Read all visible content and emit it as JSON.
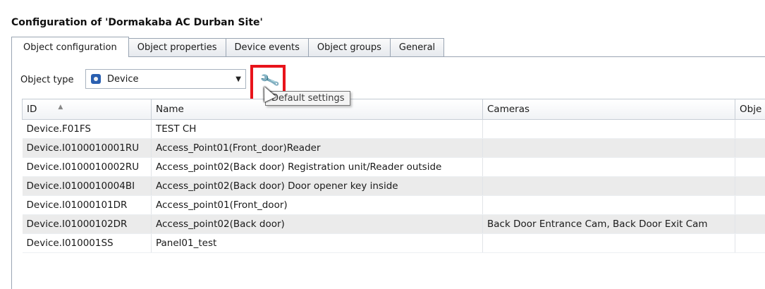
{
  "window": {
    "title": "Configuration of 'Dormakaba AC Durban Site'"
  },
  "tabs": [
    {
      "label": "Object configuration",
      "active": true
    },
    {
      "label": "Object properties",
      "active": false
    },
    {
      "label": "Device events",
      "active": false
    },
    {
      "label": "Object groups",
      "active": false
    },
    {
      "label": "General",
      "active": false
    }
  ],
  "object_type": {
    "label": "Object type",
    "selected": "Device",
    "icon": "device-icon"
  },
  "default_settings": {
    "icon": "wrench-icon",
    "tooltip": "Default settings",
    "highlight_color": "#e8141b"
  },
  "table": {
    "columns": [
      "ID",
      "Name",
      "Cameras",
      "Obje"
    ],
    "rows": [
      {
        "id": "Device.F01FS",
        "name": "TEST CH",
        "cameras": "",
        "obj": ""
      },
      {
        "id": "Device.I0100010001RU",
        "name": "Access_Point01(Front_door)Reader",
        "cameras": "",
        "obj": ""
      },
      {
        "id": "Device.I0100010002RU",
        "name": "Access_point02(Back door) Registration unit/Reader outside",
        "cameras": "",
        "obj": ""
      },
      {
        "id": "Device.I0100010004BI",
        "name": "Access_point02(Back door) Door opener key inside",
        "cameras": "",
        "obj": ""
      },
      {
        "id": "Device.I01000101DR",
        "name": "Access_point01(Front_door)",
        "cameras": "",
        "obj": ""
      },
      {
        "id": "Device.I01000102DR",
        "name": "Access_point02(Back door)",
        "cameras": "Back Door Entrance Cam, Back Door Exit Cam",
        "obj": ""
      },
      {
        "id": "Device.I010001SS",
        "name": "Panel01_test",
        "cameras": "",
        "obj": ""
      }
    ]
  }
}
